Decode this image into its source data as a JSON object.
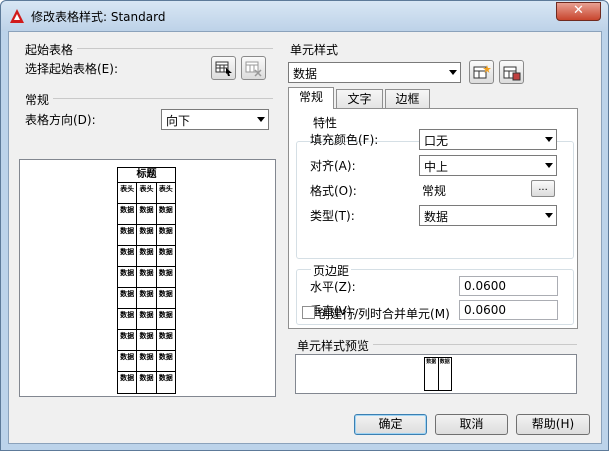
{
  "window": {
    "title": "修改表格样式: Standard",
    "close_label": "✕"
  },
  "start_table": {
    "heading": "起始表格",
    "select_label": "选择起始表格(E):"
  },
  "general": {
    "heading": "常规",
    "direction_label": "表格方向(D):",
    "direction_value": "向下"
  },
  "left_preview": {
    "title": "标题",
    "header_cell": "表头",
    "data_cell": "数据",
    "data_rows": 9
  },
  "cell_style": {
    "heading": "单元样式",
    "selected": "数据"
  },
  "tabs": [
    "常规",
    "文字",
    "边框"
  ],
  "properties": {
    "heading": "特性",
    "fill_color_label": "填充颜色(F):",
    "fill_color_value": "口无",
    "align_label": "对齐(A):",
    "align_value": "中上",
    "format_label": "格式(O):",
    "format_value": "常规",
    "format_button": "...",
    "type_label": "类型(T):",
    "type_value": "数据"
  },
  "margins": {
    "heading": "页边距",
    "horizontal_label": "水平(Z):",
    "horizontal_value": "0.0600",
    "vertical_label": "垂直(V):",
    "vertical_value": "0.0600"
  },
  "merge_checkbox": {
    "label": "创建行/列时合并单元(M)",
    "checked": false
  },
  "cell_preview": {
    "heading": "单元样式预览",
    "cell_text": "数据"
  },
  "buttons": {
    "ok": "确定",
    "cancel": "取消",
    "help": "帮助(H)"
  },
  "colors": {
    "title_bar": "#bdd2e8",
    "client_bg": "#f0f0f0",
    "close_button": "#c8452d",
    "autocad_red": "#d11b1b"
  }
}
